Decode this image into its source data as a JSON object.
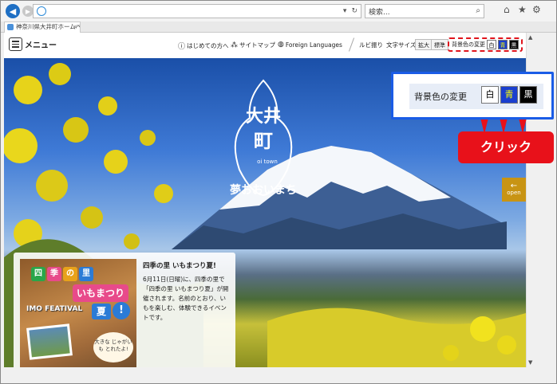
{
  "browser": {
    "address_text": "",
    "search_placeholder": "検索...",
    "tab_title": "神奈川県大井町ホームペー...",
    "tab_close": "×"
  },
  "header": {
    "menu_label": "メニュー",
    "links": [
      {
        "label": "はじめての方へ",
        "icon": "info-icon"
      },
      {
        "label": "サイトマップ",
        "icon": "sitemap-icon"
      },
      {
        "label": "Foreign Languages",
        "icon": "globe-icon"
      }
    ],
    "ruby_label": "ルビ振り",
    "text_size_label": "文字サイズ",
    "enlarge_label": "拡大",
    "standard_label": "標準",
    "bg_change_label": "背景色の変更",
    "bg_white": "白",
    "bg_blue": "青",
    "bg_black": "黒"
  },
  "hero": {
    "logo_text": "大井町",
    "logo_sub": "oi town",
    "logo_tagline": "夢おおいまち",
    "open_tab_label": "open"
  },
  "news": {
    "badge": [
      "四",
      "季",
      "の",
      "里"
    ],
    "imo_label": "いもまつり",
    "imo_festival": "IMO FEATIVAL",
    "natsu": "夏",
    "excl": "!",
    "bubble": "大きな じゃがいも とれたよ!",
    "title": "四季の里 いもまつり夏!",
    "body": "6月11日(日曜)に、四季の里で「四季の里 いもまつり夏」が開催されます。名前のとおり、いもを楽しむ、体験できるイベントです。",
    "pause_label": "II"
  },
  "callout": {
    "label": "背景色の変更",
    "white": "白",
    "blue": "青",
    "black": "黒",
    "click_label": "クリック"
  },
  "colors": {
    "accent_blue": "#1a5ce6",
    "alert_red": "#e8111a",
    "open_tab": "#c89414"
  }
}
